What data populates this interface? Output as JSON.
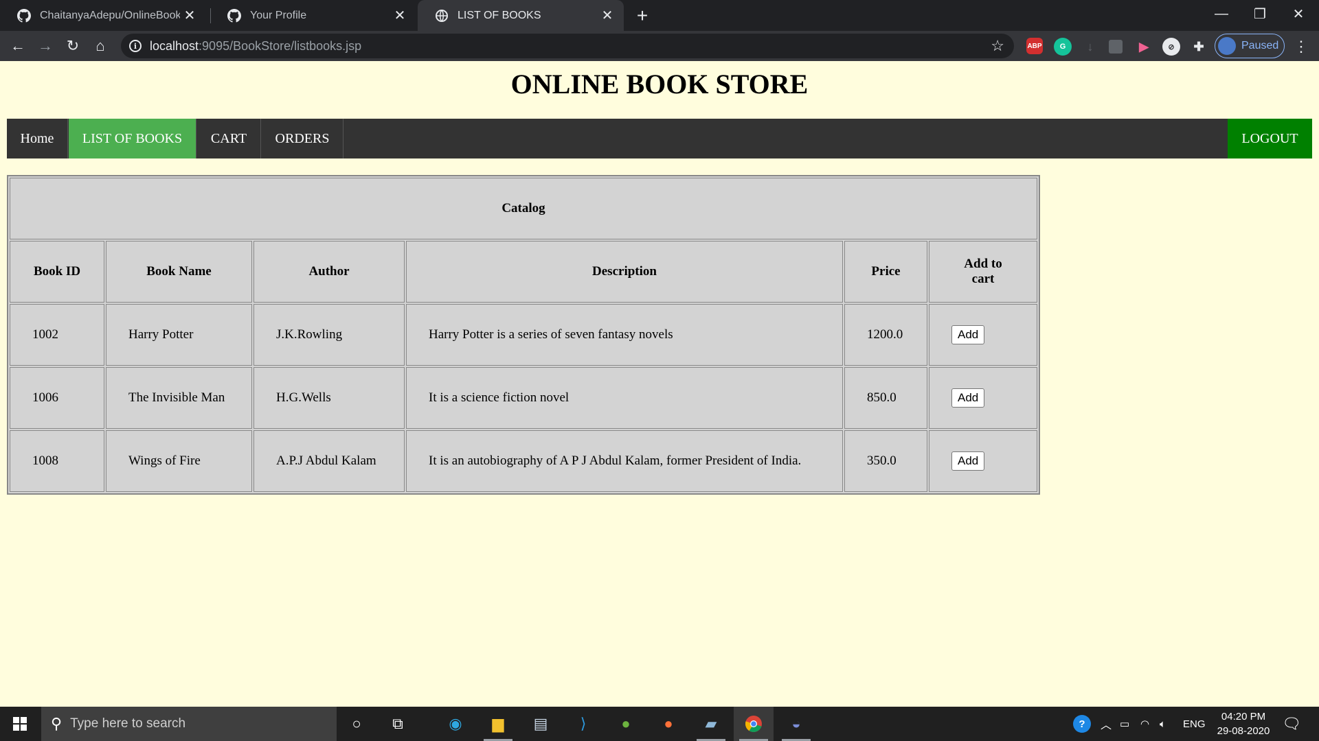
{
  "browser": {
    "tabs": [
      {
        "title": "ChaitanyaAdepu/OnlineBookStor",
        "icon": "github-icon"
      },
      {
        "title": "Your Profile",
        "icon": "github-icon"
      },
      {
        "title": "LIST OF BOOKS",
        "icon": "globe-icon",
        "active": true
      }
    ],
    "url_host": "localhost",
    "url_path": ":9095/BookStore/listbooks.jsp",
    "extensions": {
      "abp_label": "ABP"
    },
    "profile_label": "Paused"
  },
  "site": {
    "title": "ONLINE BOOK STORE",
    "nav": {
      "home": "Home",
      "list_of_books": "LIST OF BOOKS",
      "cart": "CART",
      "orders": "ORDERS",
      "logout": "LOGOUT"
    }
  },
  "catalog": {
    "caption": "Catalog",
    "headers": {
      "book_id": "Book ID",
      "book_name": "Book Name",
      "author": "Author",
      "description": "Description",
      "price": "Price",
      "add_to_cart": "Add to cart"
    },
    "rows": [
      {
        "id": "1002",
        "name": "Harry Potter",
        "author": "J.K.Rowling",
        "description": "Harry Potter is a series of seven fantasy novels",
        "price": "1200.0",
        "button": "Add"
      },
      {
        "id": "1006",
        "name": "The Invisible Man",
        "author": "H.G.Wells",
        "description": "It is a science fiction novel",
        "price": "850.0",
        "button": "Add"
      },
      {
        "id": "1008",
        "name": "Wings of Fire",
        "author": "A.P.J Abdul Kalam",
        "description": "It is an autobiography of A P J Abdul Kalam, former President of India.",
        "price": "350.0",
        "button": "Add"
      }
    ]
  },
  "taskbar": {
    "search_placeholder": "Type here to search",
    "language": "ENG",
    "time": "04:20 PM",
    "date": "29-08-2020"
  },
  "colors": {
    "page_bg": "#fffddd",
    "navbar_bg": "#333333",
    "nav_active": "#4caf50",
    "logout_bg": "#008000",
    "table_bg": "#d3d3d3"
  }
}
